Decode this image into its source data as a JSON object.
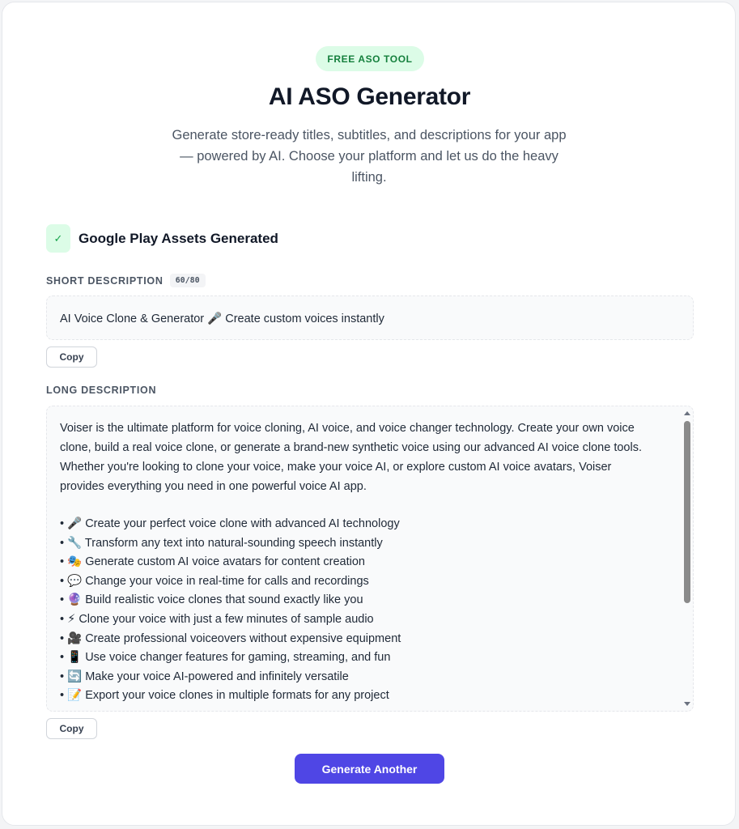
{
  "header": {
    "badge": "FREE ASO TOOL",
    "title": "AI ASO Generator",
    "subtitle": "Generate store-ready titles, subtitles, and descriptions for your app — powered by AI. Choose your platform and let us do the heavy lifting."
  },
  "result": {
    "status_icon": "check-icon",
    "status_title": "Google Play Assets Generated",
    "short_description": {
      "label": "SHORT DESCRIPTION",
      "counter": "60/80",
      "value": "AI Voice Clone & Generator 🎤 Create custom voices instantly",
      "copy_label": "Copy"
    },
    "long_description": {
      "label": "LONG DESCRIPTION",
      "intro": "Voiser is the ultimate platform for voice cloning, AI voice, and voice changer technology. Create your own voice clone, build a real voice clone, or generate a brand-new synthetic voice using our advanced AI voice clone tools. Whether you're looking to clone your voice, make your voice AI, or explore custom AI voice avatars, Voiser provides everything you need in one powerful voice AI app.",
      "bullets": [
        "• 🎤 Create your perfect voice clone with advanced AI technology",
        "• 🔧 Transform any text into natural-sounding speech instantly",
        "• 🎭 Generate custom AI voice avatars for content creation",
        "• 💬 Change your voice in real-time for calls and recordings",
        "• 🔮 Build realistic voice clones that sound exactly like you",
        "• ⚡ Clone your voice with just a few minutes of sample audio",
        "• 🎥 Create professional voiceovers without expensive equipment",
        "• 📱 Use voice changer features for gaming, streaming, and fun",
        "• 🔄 Make your voice AI-powered and infinitely versatile",
        "• 📝 Export your voice clones in multiple formats for any project"
      ],
      "copy_label": "Copy"
    },
    "generate_another_label": "Generate Another"
  },
  "colors": {
    "accent": "#4f46e5",
    "badge_bg": "#dcfce7",
    "badge_text": "#15803d"
  }
}
